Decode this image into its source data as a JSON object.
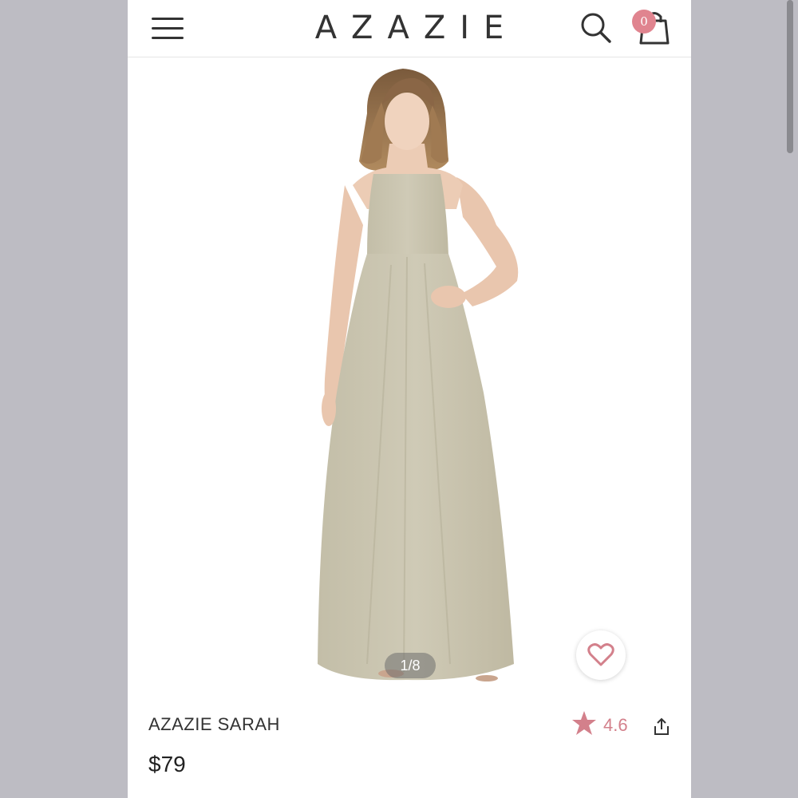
{
  "header": {
    "logo": "AZAZIE",
    "cart_count": "0"
  },
  "gallery": {
    "page_counter": "1/8",
    "dress_color": "#cbc6b1"
  },
  "product": {
    "name": "AZAZIE SARAH",
    "price": "$79",
    "rating": "4.6"
  },
  "colors": {
    "accent": "#e0848f",
    "rating": "#d3808b"
  },
  "icons": [
    "menu-icon",
    "search-icon",
    "shopping-bag-icon",
    "heart-icon",
    "star-icon",
    "share-icon"
  ]
}
